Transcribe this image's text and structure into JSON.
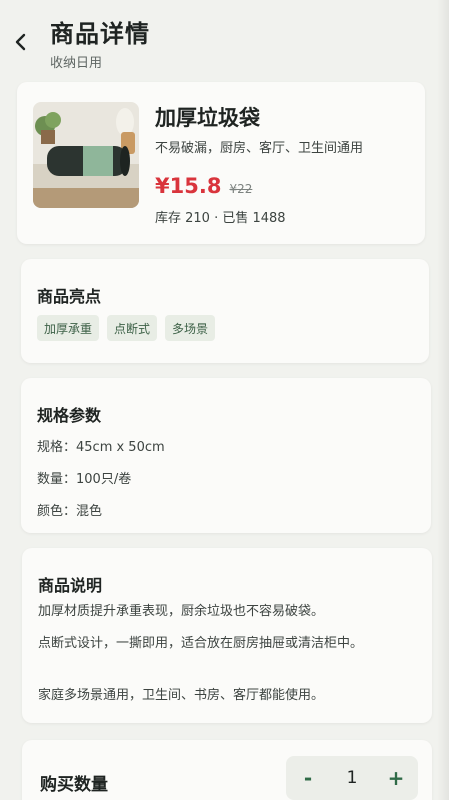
{
  "header": {
    "title": "商品详情",
    "subtitle": "收纳日用"
  },
  "product": {
    "name": "加厚垃圾袋",
    "description": "不易破漏，厨房、客厅、卫生间通用",
    "price": "¥15.8",
    "original_price": "¥22",
    "stock_sales": "库存 210 · 已售 1488"
  },
  "highlights": {
    "title": "商品亮点",
    "tags": [
      "加厚承重",
      "点断式",
      "多场景"
    ]
  },
  "specs": {
    "title": "规格参数",
    "lines": [
      "规格：45cm x 50cm",
      "数量：100只/卷",
      "颜色：混色"
    ]
  },
  "details": {
    "title": "商品说明",
    "paragraphs": [
      "加厚材质提升承重表现，厨余垃圾也不容易破袋。",
      "点断式设计，一撕即用，适合放在厨房抽屉或清洁柜中。",
      "家庭多场景通用，卫生间、书房、客厅都能使用。"
    ]
  },
  "quantity": {
    "label": "购买数量",
    "minus": "-",
    "value": "1",
    "plus": "+"
  },
  "colors": {
    "price": "#d9343c",
    "accent": "#2f6b47",
    "tag_bg": "#e8ede5",
    "tag_text": "#3d6147"
  }
}
